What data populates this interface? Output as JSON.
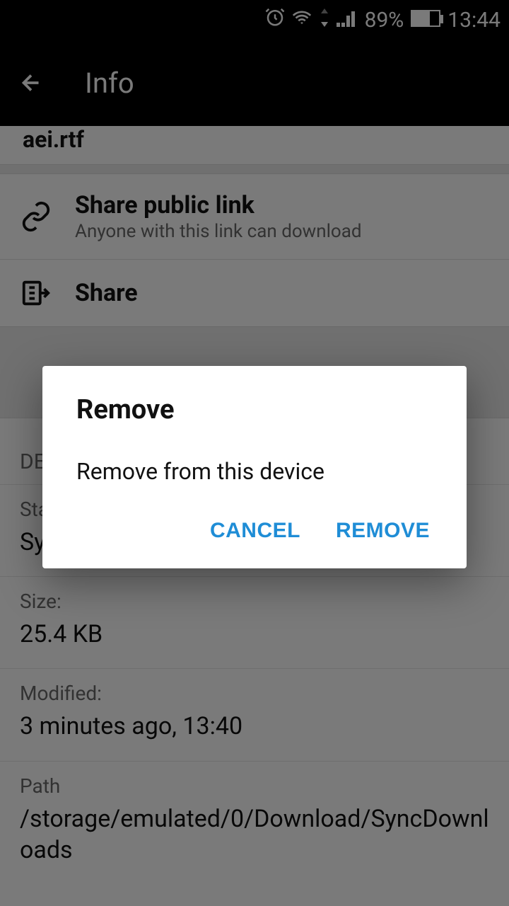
{
  "status": {
    "battery_pct": "89%",
    "time": "13:44"
  },
  "header": {
    "title": "Info"
  },
  "file": {
    "name": "aei.rtf"
  },
  "actions": {
    "share_link_title": "Share public link",
    "share_link_sub": "Anyone with this link can download",
    "share_title": "Share"
  },
  "details": {
    "header": "DETAILS",
    "status_label": "Status",
    "status_value": "Sync",
    "size_label": "Size:",
    "size_value": "25.4 KB",
    "modified_label": "Modified:",
    "modified_value": "3 minutes ago, 13:40",
    "path_label": "Path",
    "path_value": "/storage/emulated/0/Download/SyncDownloads"
  },
  "dialog": {
    "title": "Remove",
    "message": "Remove from this device",
    "cancel": "CANCEL",
    "confirm": "REMOVE"
  }
}
